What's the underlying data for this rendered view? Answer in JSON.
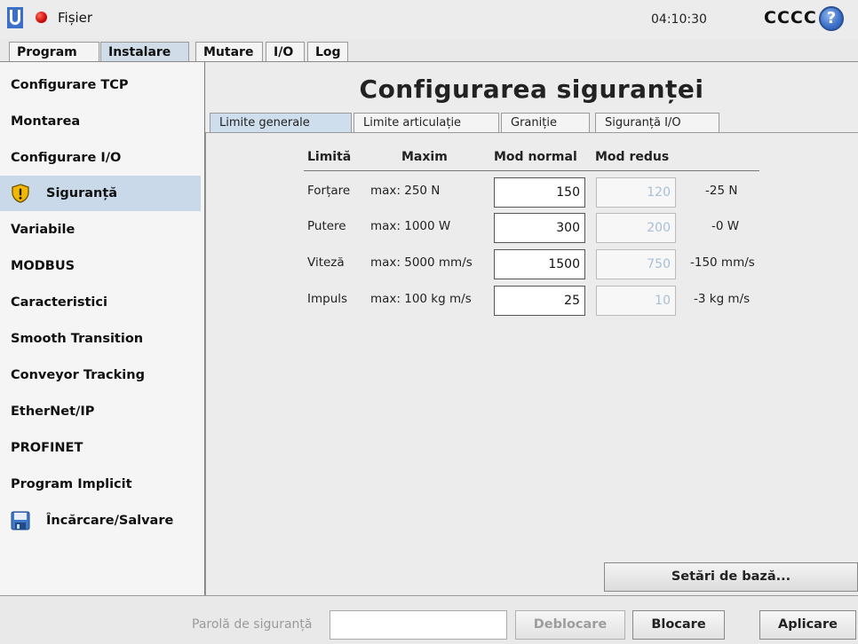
{
  "topbar": {
    "file_label": "Fișier",
    "time": "04:10:30",
    "robot_name": "CCCC",
    "help_glyph": "?"
  },
  "main_tabs": [
    {
      "label": "Program"
    },
    {
      "label": "Instalare"
    },
    {
      "label": "Mutare"
    },
    {
      "label": "I/O"
    },
    {
      "label": "Log"
    }
  ],
  "sidebar": {
    "items": [
      {
        "label": "Configurare TCP"
      },
      {
        "label": "Montarea"
      },
      {
        "label": "Configurare I/O"
      },
      {
        "label": "Siguranță",
        "icon": "warning-shield-icon"
      },
      {
        "label": "Variabile"
      },
      {
        "label": "MODBUS"
      },
      {
        "label": "Caracteristici"
      },
      {
        "label": "Smooth Transition"
      },
      {
        "label": "Conveyor Tracking"
      },
      {
        "label": "EtherNet/IP"
      },
      {
        "label": "PROFINET"
      },
      {
        "label": "Program Implicit"
      },
      {
        "label": "Încărcare/Salvare",
        "icon": "floppy-disk-icon"
      }
    ]
  },
  "content": {
    "title": "Configurarea siguranței",
    "sub_tabs": [
      {
        "label": "Limite generale"
      },
      {
        "label": "Limite articulație"
      },
      {
        "label": "Graniție"
      },
      {
        "label": "Siguranță I/O"
      }
    ],
    "columns": {
      "limit": "Limită",
      "max": "Maxim",
      "normal": "Mod normal",
      "reduced": "Mod redus"
    },
    "rows": [
      {
        "label": "Forțare",
        "max": "max: 250 N",
        "normal": "150",
        "reduced": "120",
        "delta": "-25 N"
      },
      {
        "label": "Putere",
        "max": "max: 1000 W",
        "normal": "300",
        "reduced": "200",
        "delta": "-0 W"
      },
      {
        "label": "Viteză",
        "max": "max: 5000 mm/s",
        "normal": "1500",
        "reduced": "750",
        "delta": "-150 mm/s"
      },
      {
        "label": "Impuls",
        "max": "max: 100 kg m/s",
        "normal": "25",
        "reduced": "10",
        "delta": "-3 kg m/s"
      }
    ],
    "base_settings_button": "Setări de bază..."
  },
  "bottom": {
    "password_label": "Parolă de siguranță",
    "password_value": "",
    "unlock_button": "Deblocare",
    "lock_button": "Blocare",
    "apply_button": "Aplicare"
  }
}
